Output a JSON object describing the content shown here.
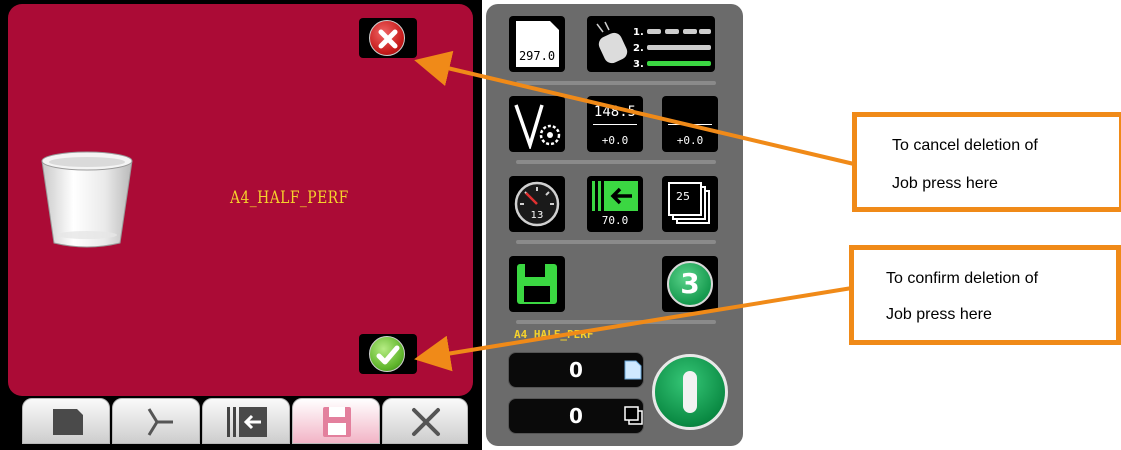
{
  "dialog": {
    "job_name": "A4_HALF_PERF",
    "cancel_button": "cancel-delete",
    "confirm_button": "confirm-delete"
  },
  "tabs": [
    "document-icon",
    "knife-icon",
    "feed-icon",
    "save-icon",
    "tools-icon"
  ],
  "panel": {
    "paper_length": "297.0",
    "perf_top": "148.5",
    "perf_offset_1": "+0.0",
    "perf_offset_2": "+0.0",
    "speed": "13",
    "feed_value": "70.0",
    "batch_count": "25",
    "program_number": "3",
    "job_label": "A4_HALF_PERF",
    "sheet_counter": "0",
    "batch_counter": "0"
  },
  "callouts": {
    "cancel": {
      "line1": "To cancel deletion of",
      "line2": "Job press here"
    },
    "confirm": {
      "line1": "To confirm deletion of",
      "line2": "Job press here"
    }
  },
  "colors": {
    "dialog_bg": "#ab0b36",
    "accent_orange": "#f08a18",
    "job_text": "#f5d22c"
  }
}
